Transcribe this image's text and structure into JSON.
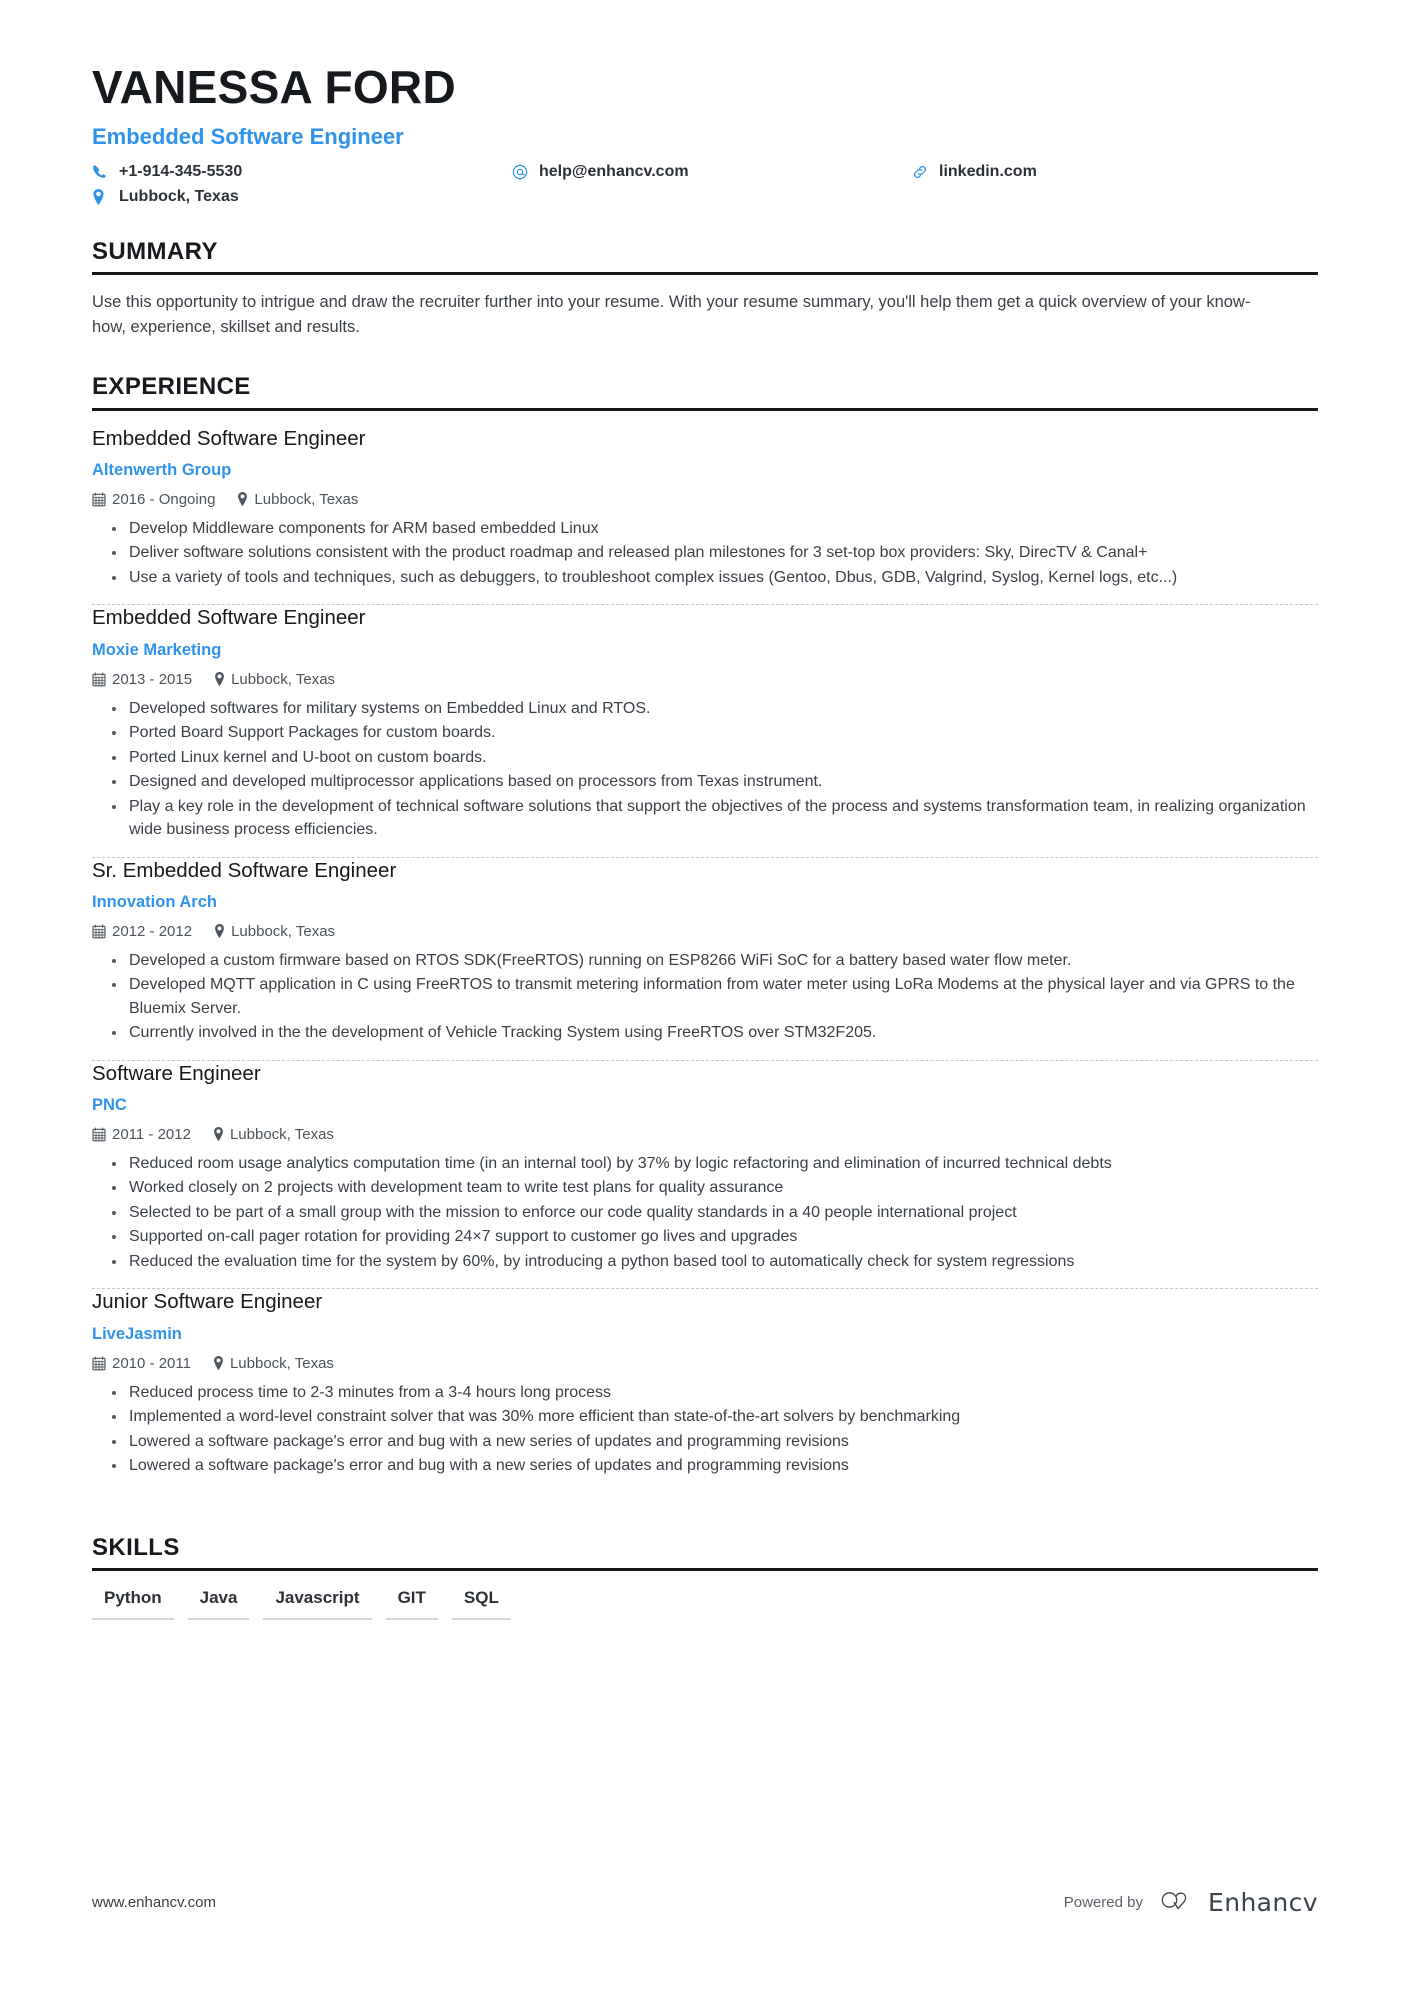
{
  "colors": {
    "accent": "#2f93ec",
    "text": "#2c3137",
    "muted": "#3a4047",
    "rule": "#16191d",
    "divider": "#c3c8cd"
  },
  "header": {
    "full_name": "VANESSA FORD",
    "job_title": "Embedded Software Engineer",
    "contacts": [
      {
        "icon": "phone-icon",
        "value": "+1-914-345-5530"
      },
      {
        "icon": "email-icon",
        "value": "help@enhancv.com"
      },
      {
        "icon": "link-icon",
        "value": "linkedin.com"
      },
      {
        "icon": "location-pin-icon",
        "value": "Lubbock, Texas"
      }
    ]
  },
  "sections": {
    "summary": {
      "title": "SUMMARY",
      "text": "Use this opportunity to intrigue and draw the recruiter further into your resume. With your resume summary, you'll help them get a quick overview of your know-how, experience, skillset and results."
    },
    "experience": {
      "title": "EXPERIENCE",
      "jobs": [
        {
          "role": "Embedded Software Engineer",
          "company": "Altenwerth Group",
          "dates": "2016 - Ongoing",
          "location": "Lubbock, Texas",
          "bullets": [
            "Develop Middleware components for ARM based embedded Linux",
            "Deliver software solutions consistent with the product roadmap and released plan milestones for 3 set-top box providers: Sky, DirecTV & Canal+",
            "Use a variety of tools and techniques, such as debuggers, to troubleshoot complex issues (Gentoo, Dbus, GDB, Valgrind, Syslog, Kernel logs, etc...)"
          ]
        },
        {
          "role": "Embedded Software Engineer",
          "company": "Moxie Marketing",
          "dates": "2013 - 2015",
          "location": "Lubbock, Texas",
          "bullets": [
            "Developed softwares for military systems on Embedded Linux and RTOS.",
            "Ported Board Support Packages for custom boards.",
            "Ported Linux kernel and U-boot on custom boards.",
            "Designed and developed multiprocessor applications based on processors from Texas instrument.",
            "Play a key role in the development of technical software solutions that support the objectives of the process and systems transformation team, in realizing organization wide business process efficiencies."
          ]
        },
        {
          "role": "Sr. Embedded Software Engineer",
          "company": "Innovation Arch",
          "dates": "2012 - 2012",
          "location": "Lubbock, Texas",
          "bullets": [
            "Developed a custom firmware based on RTOS SDK(FreeRTOS) running on ESP8266 WiFi SoC for a battery based water flow meter.",
            "Developed MQTT application in C using FreeRTOS to transmit metering information from water meter using LoRa Modems at the physical layer and via GPRS to the Bluemix Server.",
            "Currently involved in the the development of Vehicle Tracking System using FreeRTOS over STM32F205."
          ]
        },
        {
          "role": "Software Engineer",
          "company": "PNC",
          "dates": "2011 - 2012",
          "location": "Lubbock, Texas",
          "bullets": [
            "Reduced room usage analytics computation time (in an internal tool) by 37% by logic refactoring and elimination of incurred technical debts",
            "Worked closely on 2 projects with development team to write test plans for quality assurance",
            "Selected to be part of a small group with the mission to enforce our code quality standards in a 40 people international project",
            "Supported on-call pager rotation for providing 24×7 support to customer go lives and upgrades",
            "Reduced the evaluation time for the system by 60%, by introducing a python based tool to automatically check for system regressions"
          ]
        },
        {
          "role": "Junior Software Engineer",
          "company": "LiveJasmin",
          "dates": "2010 - 2011",
          "location": "Lubbock, Texas",
          "bullets": [
            "Reduced process time to 2-3 minutes from a 3-4 hours long process",
            "Implemented a word-level constraint solver that was 30% more efficient than state-of-the-art solvers by benchmarking",
            "Lowered a software package's error and bug with a new series of updates and programming revisions",
            "Lowered a software package's error and bug with a new series of updates and programming revisions"
          ]
        }
      ]
    },
    "skills": {
      "title": "SKILLS",
      "items": [
        "Python",
        "Java",
        "Javascript",
        "GIT",
        "SQL"
      ]
    }
  },
  "footer": {
    "website": "www.enhancv.com",
    "powered_by": "Powered by",
    "brand": "Enhancv"
  }
}
